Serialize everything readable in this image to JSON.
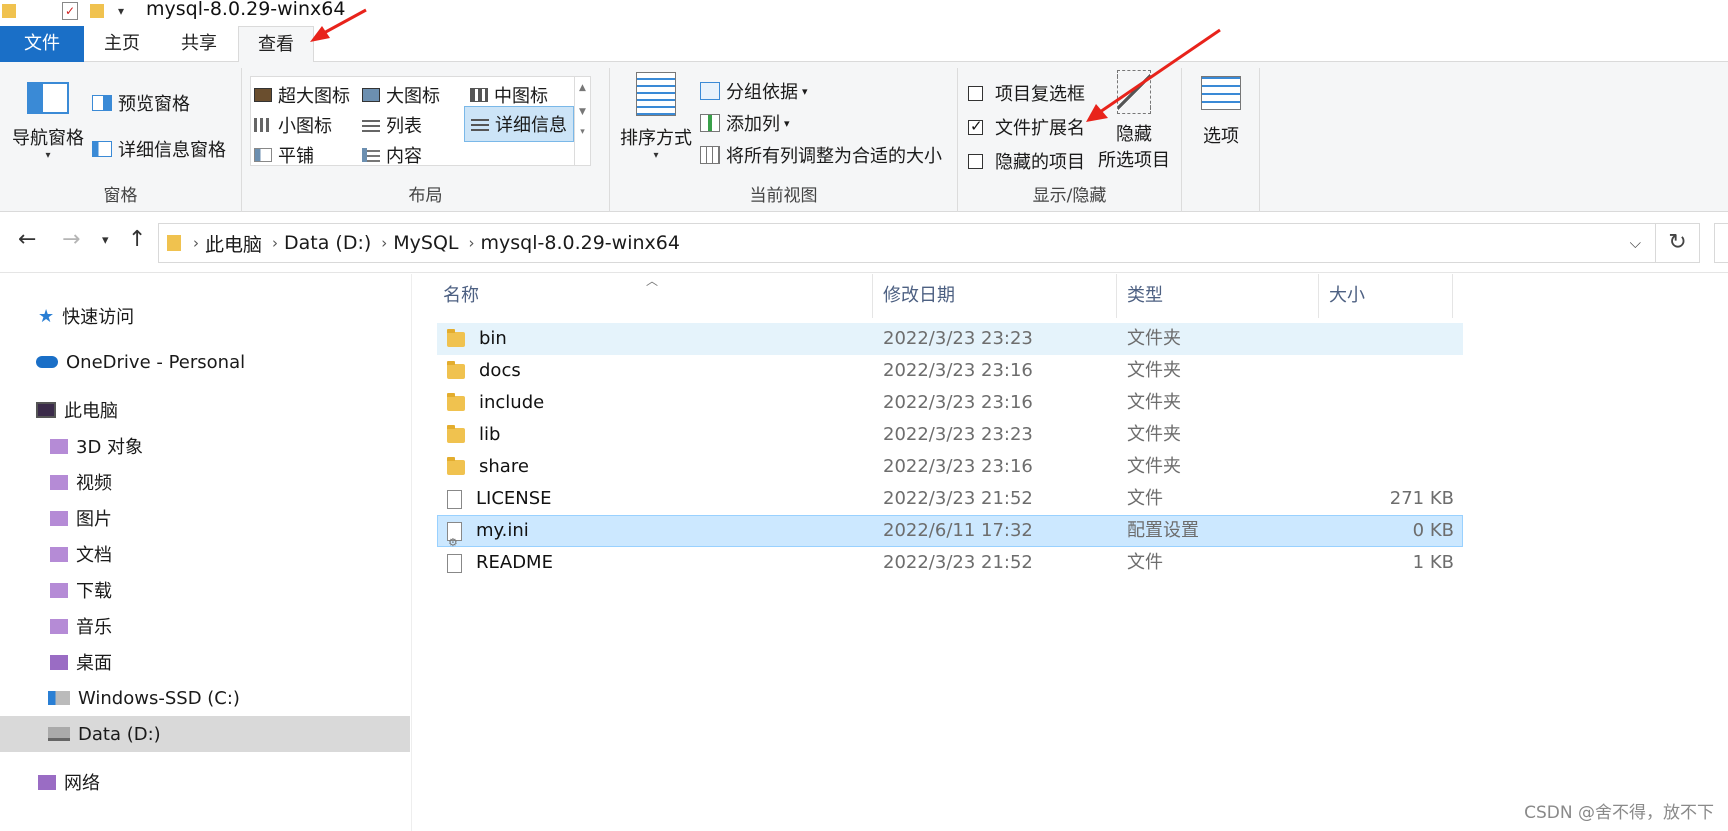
{
  "window": {
    "title": "mysql-8.0.29-winx64"
  },
  "tabs": [
    {
      "label": "文件"
    },
    {
      "label": "主页"
    },
    {
      "label": "共享"
    },
    {
      "label": "查看"
    }
  ],
  "ribbon": {
    "pane": {
      "nav_pane": "导航窗格",
      "preview_pane": "预览窗格",
      "details_pane": "详细信息窗格",
      "group_label": "窗格"
    },
    "layout": {
      "items": [
        "超大图标",
        "大图标",
        "中图标",
        "小图标",
        "列表",
        "详细信息",
        "平铺",
        "内容"
      ],
      "group_label": "布局"
    },
    "current_view": {
      "sort_by": "排序方式",
      "group_by": "分组依据",
      "add_column": "添加列",
      "size_all": "将所有列调整为合适的大小",
      "group_label": "当前视图"
    },
    "show_hide": {
      "item_checkboxes": "项目复选框",
      "file_extensions": "文件扩展名",
      "hidden_items": "隐藏的项目",
      "hide_selected_line1": "隐藏",
      "hide_selected_line2": "所选项目",
      "group_label": "显示/隐藏",
      "checked": {
        "item_checkboxes": false,
        "file_extensions": true,
        "hidden_items": false
      }
    },
    "options": {
      "label": "选项"
    }
  },
  "address": {
    "crumbs": [
      "此电脑",
      "Data (D:)",
      "MySQL",
      "mysql-8.0.29-winx64"
    ]
  },
  "navpane": {
    "quick_access": "快速访问",
    "onedrive": "OneDrive - Personal",
    "this_pc": "此电脑",
    "pc_items": [
      "3D 对象",
      "视频",
      "图片",
      "文档",
      "下载",
      "音乐",
      "桌面",
      "Windows-SSD (C:)",
      "Data (D:)"
    ],
    "network": "网络"
  },
  "columns": {
    "name": "名称",
    "date": "修改日期",
    "type": "类型",
    "size": "大小"
  },
  "files": [
    {
      "name": "bin",
      "date": "2022/3/23 23:23",
      "type": "文件夹",
      "size": "",
      "icon": "folder"
    },
    {
      "name": "docs",
      "date": "2022/3/23 23:16",
      "type": "文件夹",
      "size": "",
      "icon": "folder"
    },
    {
      "name": "include",
      "date": "2022/3/23 23:16",
      "type": "文件夹",
      "size": "",
      "icon": "folder"
    },
    {
      "name": "lib",
      "date": "2022/3/23 23:23",
      "type": "文件夹",
      "size": "",
      "icon": "folder"
    },
    {
      "name": "share",
      "date": "2022/3/23 23:16",
      "type": "文件夹",
      "size": "",
      "icon": "folder"
    },
    {
      "name": "LICENSE",
      "date": "2022/3/23 21:52",
      "type": "文件",
      "size": "271 KB",
      "icon": "file"
    },
    {
      "name": "my.ini",
      "date": "2022/6/11 17:32",
      "type": "配置设置",
      "size": "0 KB",
      "icon": "ini"
    },
    {
      "name": "README",
      "date": "2022/3/23 21:52",
      "type": "文件",
      "size": "1 KB",
      "icon": "file"
    }
  ],
  "watermark": "CSDN @舍不得，放不下",
  "colors": {
    "accent": "#1a6fc7",
    "annotation_arrow": "#e8231b",
    "selection": "#cce8ff"
  }
}
